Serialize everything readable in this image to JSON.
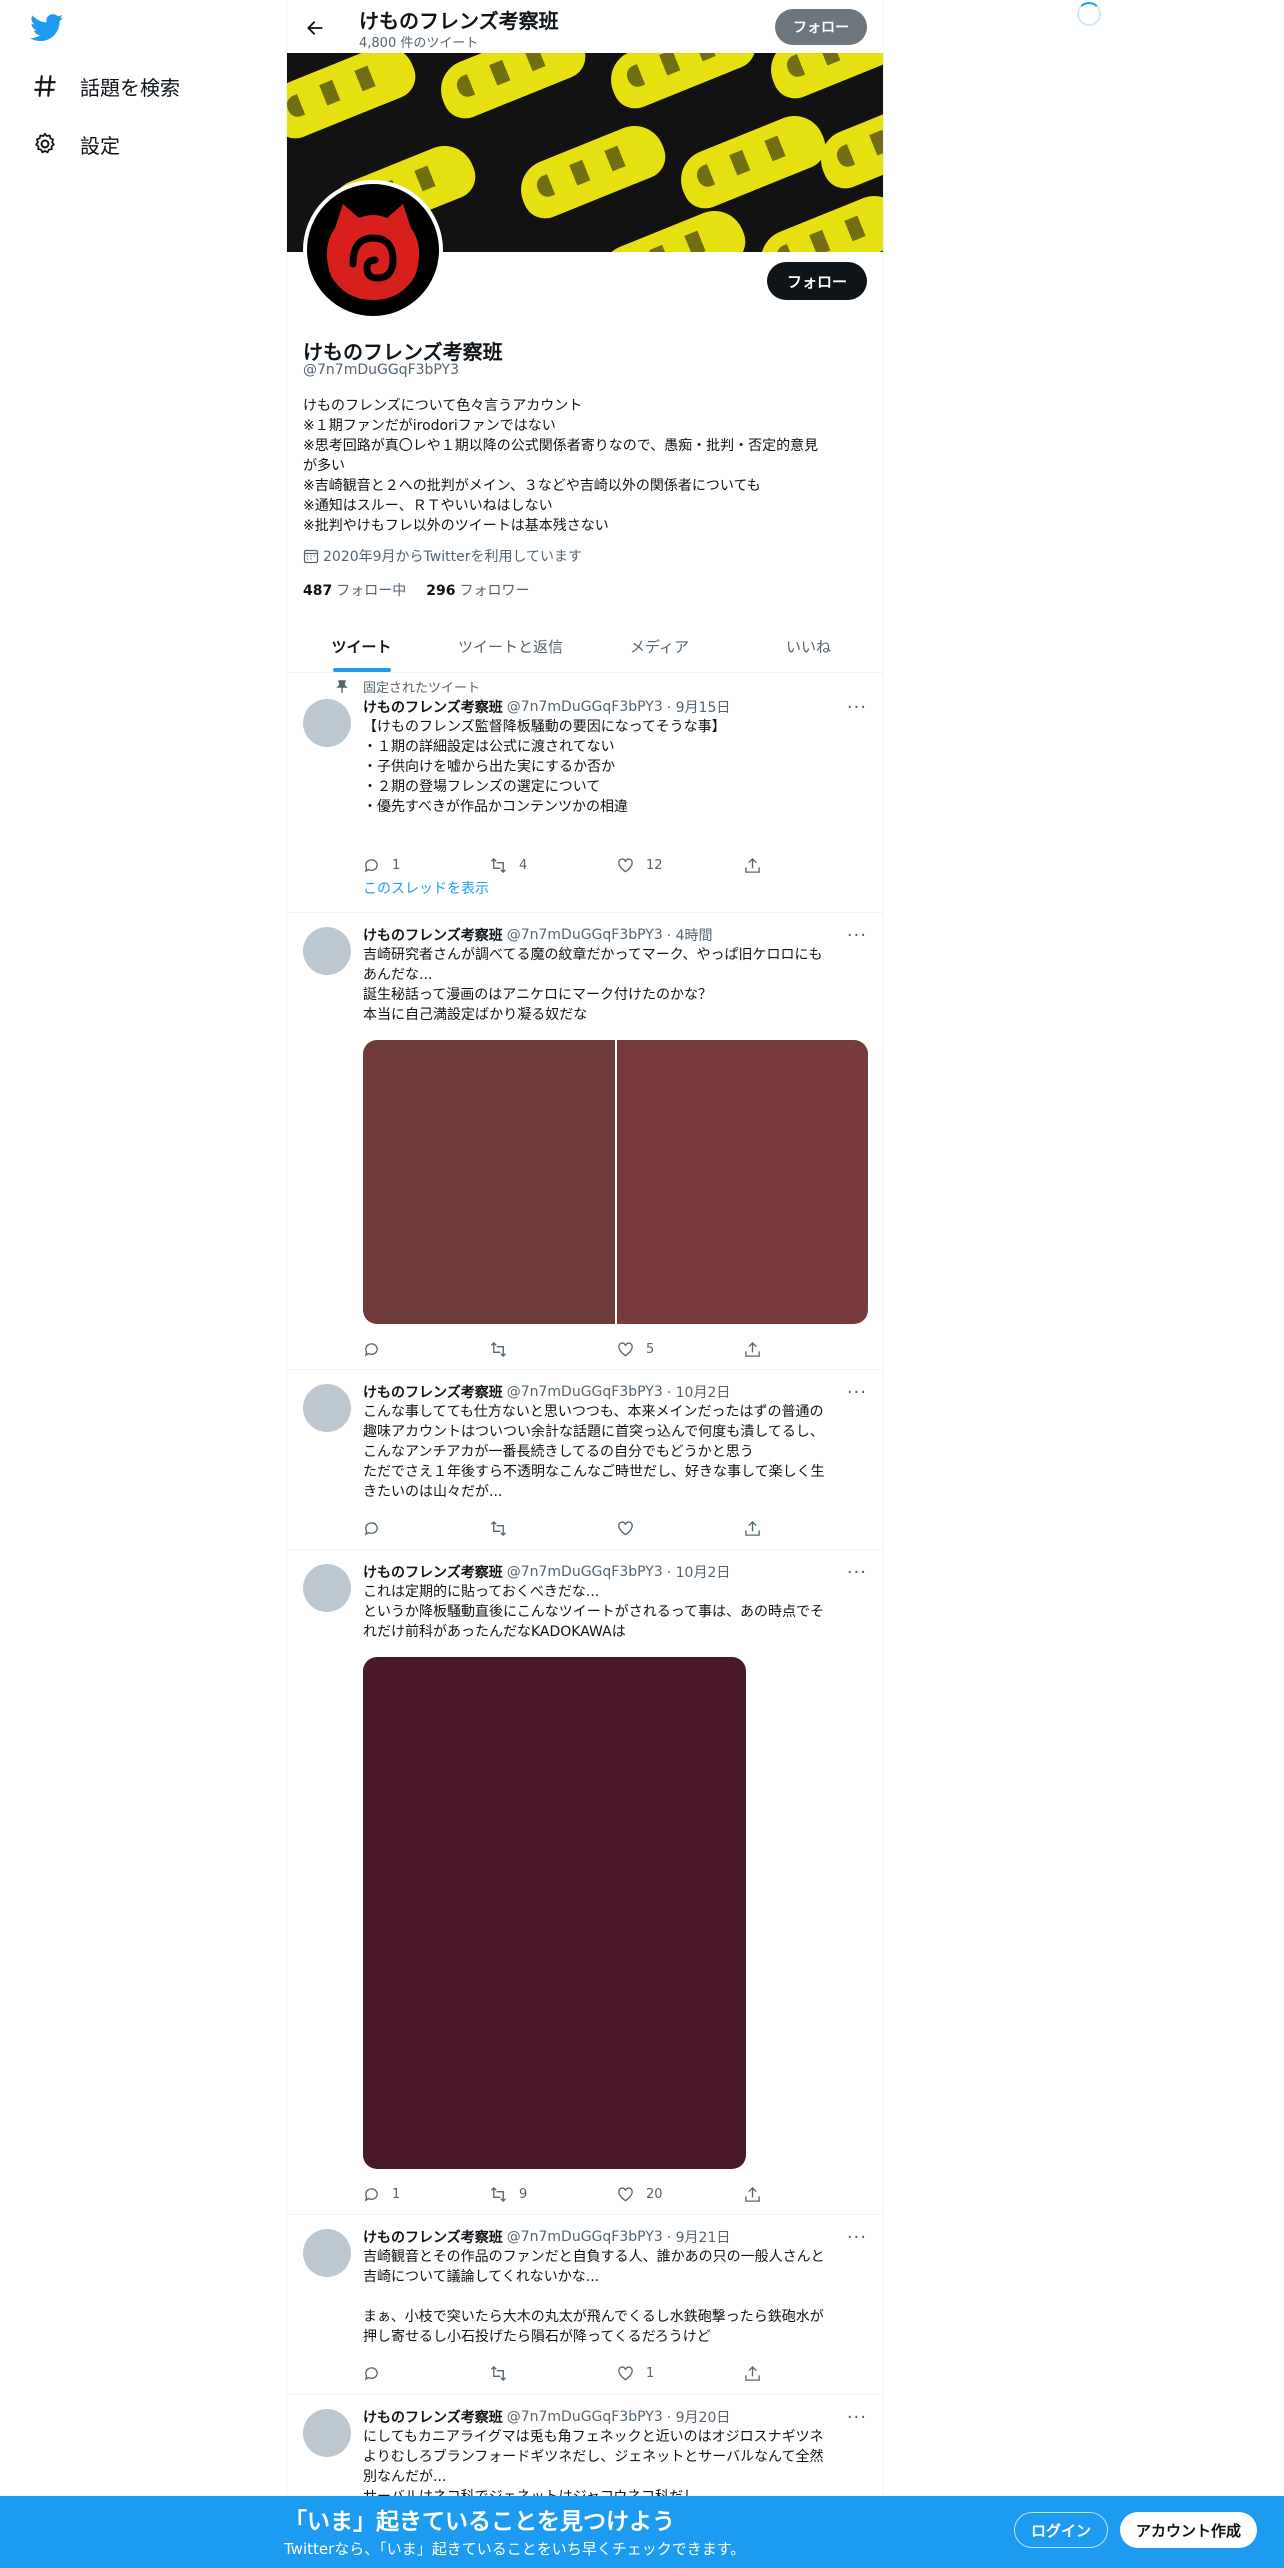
{
  "nav": {
    "explore_label": "話題を検索",
    "settings_label": "設定"
  },
  "header": {
    "name": "けものフレンズ考察班",
    "tweet_count": "4,800 件のツイート",
    "follow_label": "フォロー"
  },
  "profile": {
    "follow_label": "フォロー",
    "name": "けものフレンズ考察班",
    "handle": "@7n7mDuGGqF3bPY3",
    "bio": [
      "けものフレンズについて色々言うアカウント",
      "※１期ファンだがirodoriファンではない",
      "※思考回路が真〇レや１期以降の公式関係者寄りなので、愚痴・批判・否定的意見",
      "が多い",
      "※吉崎観音と２への批判がメイン、３などや吉崎以外の関係者についても",
      "※通知はスルー、ＲＴやいいねはしない",
      "※批判やけもフレ以外のツイートは基本残さない"
    ],
    "joined": "2020年9月からTwitterを利用しています",
    "following_count": "487",
    "following_label": "フォロー中",
    "followers_count": "296",
    "followers_label": "フォロワー"
  },
  "tabs": [
    "ツイート",
    "ツイートと返信",
    "メディア",
    "いいね"
  ],
  "pinned_label": "固定されたツイート",
  "thread_link": "このスレッドを表示",
  "tweets": [
    {
      "name": "けものフレンズ考察班",
      "handle": "@7n7mDuGGqF3bPY3",
      "time": "· 9月15日",
      "lines": [
        "【けものフレンズ監督降板騒動の要因になってそうな事】",
        "・１期の詳細設定は公式に渡されてない",
        "・子供向けを嘘から出た実にするか否か",
        "・２期の登場フレンズの選定について",
        "・優先すべきが作品かコンテンツかの相違"
      ],
      "replies": "1",
      "retweets": "4",
      "likes": "12"
    },
    {
      "name": "けものフレンズ考察班",
      "handle": "@7n7mDuGGqF3bPY3",
      "time": "· 4時間",
      "lines": [
        "吉崎研究者さんが調べてる魔の紋章だかってマーク、やっぱ旧ケロロにも",
        "あんだな...",
        "誕生秘話って漫画のはアニケロにマーク付けたのかな？",
        "本当に自己満設定ばかり凝る奴だな"
      ],
      "replies": "",
      "retweets": "",
      "likes": "5"
    },
    {
      "name": "けものフレンズ考察班",
      "handle": "@7n7mDuGGqF3bPY3",
      "time": "· 10月2日",
      "lines": [
        "こんな事してても仕方ないと思いつつも、本来メインだったはずの普通の",
        "趣味アカウントはついつい余計な話題に首突っ込んで何度も潰してるし、",
        "こんなアンチアカが一番長続きしてるの自分でもどうかと思う",
        "ただでさえ１年後すら不透明なこんなご時世だし、好きな事して楽しく生",
        "きたいのは山々だが..."
      ],
      "replies": "",
      "retweets": "",
      "likes": ""
    },
    {
      "name": "けものフレンズ考察班",
      "handle": "@7n7mDuGGqF3bPY3",
      "time": "· 10月2日",
      "lines": [
        "これは定期的に貼っておくべきだな...",
        "というか降板騒動直後にこんなツイートがされるって事は、あの時点でそ",
        "れだけ前科があったんだなKADOKAWAは"
      ],
      "replies": "1",
      "retweets": "9",
      "likes": "20"
    },
    {
      "name": "けものフレンズ考察班",
      "handle": "@7n7mDuGGqF3bPY3",
      "time": "· 9月21日",
      "lines": [
        "吉崎観音とその作品のファンだと自負する人、誰かあの只の一般人さんと",
        "吉崎について議論してくれないかな...",
        "",
        "まぁ、小枝で突いたら大木の丸太が飛んでくるし水鉄砲撃ったら鉄砲水が",
        "押し寄せるし小石投げたら隕石が降ってくるだろうけど"
      ],
      "replies": "",
      "retweets": "",
      "likes": "1"
    },
    {
      "name": "けものフレンズ考察班",
      "handle": "@7n7mDuGGqF3bPY3",
      "time": "· 9月20日",
      "lines": [
        "にしてもカニアライグマは兎も角フェネックと近いのはオジロスナギツネ",
        "よりむしろブランフォードギツネだし、ジェネットとサーバルなんて全然",
        "別なんだが...",
        "サーバルはネコ科でジェネットはジャコウネコ科だし"
      ],
      "replies": "",
      "retweets": "",
      "likes": ""
    }
  ],
  "bottom": {
    "title": "「いま」起きていることを見つけよう",
    "subtitle": "Twitterなら、「いま」起きていることをいち早くチェックできます。",
    "login_label": "ログイン",
    "signup_label": "アカウント作成"
  },
  "colors": {
    "accent": "#1d9bf0",
    "banner_yellow": "#e6e011",
    "avatar_red": "#d7201d"
  }
}
